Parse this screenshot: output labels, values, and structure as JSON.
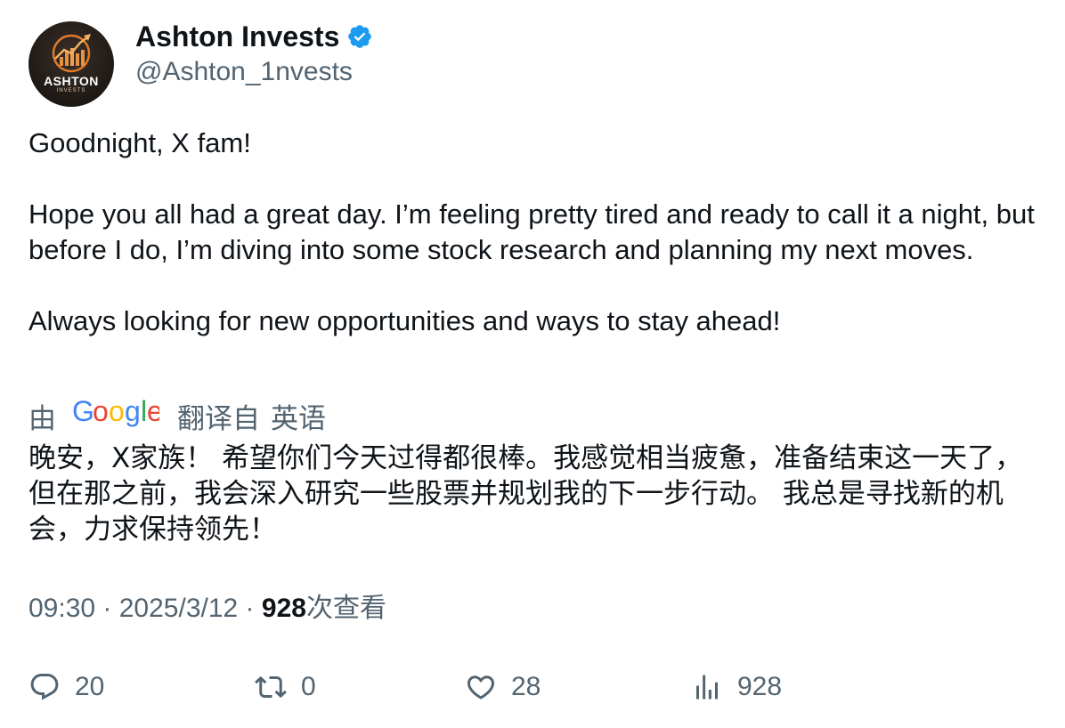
{
  "author": {
    "display_name": "Ashton Invests",
    "handle": "@Ashton_1nvests",
    "verified": true,
    "avatar_text": "ASHTON",
    "avatar_subtext": "INVESTS"
  },
  "tweet": {
    "paragraphs": [
      "Goodnight, X fam!",
      "Hope you all had a great day. I’m feeling pretty tired and ready to call it a night, but before I do, I’m diving into some stock research and planning my next moves.",
      "Always looking for new opportunities and ways to stay ahead!"
    ]
  },
  "translation": {
    "by_label": "由",
    "google_word": "Google",
    "translated_from_label": "翻译自",
    "language": "英语",
    "text": "晚安，X家族！ 希望你们今天过得都很棒。我感觉相当疲惫，准备结束这一天了，但在那之前，我会深入研究一些股票并规划我的下一步行动。 我总是寻找新的机会，力求保持领先！"
  },
  "meta": {
    "time": "09:30",
    "separator": " · ",
    "date": "2025/3/12",
    "views_count": "928",
    "views_label": "次查看"
  },
  "actions": {
    "reply_count": "20",
    "retweet_count": "0",
    "like_count": "28",
    "views_count": "928"
  },
  "colors": {
    "text_primary": "#0f1419",
    "text_secondary": "#536471",
    "verified_blue": "#1d9bf0"
  },
  "icons": [
    "verified-badge-icon",
    "google-logo",
    "reply-icon",
    "retweet-icon",
    "like-icon",
    "views-icon"
  ]
}
